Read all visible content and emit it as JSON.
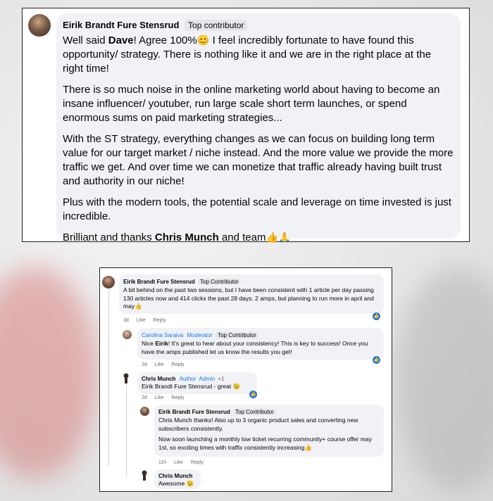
{
  "post1": {
    "author": "Eirik Brandt Fure Stensrud",
    "badge": "Top contributor",
    "p1_pre": "Well said ",
    "p1_bold": "Dave",
    "p1_mid": "! Agree 100%",
    "p1_emoji": "😊",
    "p1_post": " I feel incredibly fortunate to have found this opportunity/ strategy. There is nothing like it and we are in the right place at the right time!",
    "p2": "There is so much noise in the online marketing world about having to become an insane influencer/ youtuber, run large scale short term launches, or spend enormous sums on paid marketing strategies...",
    "p3": "With the ST strategy, everything changes as we can focus on building long term value for our target market / niche instead. And the more value we provide the more traffic we get. And over time we can monetize that traffic already having built trust and authority in our niche!",
    "p4": "Plus with the modern tools, the potential scale and leverage on time invested is just incredible.",
    "p5_pre": "Brilliant and thanks ",
    "p5_bold": "Chris Munch",
    "p5_post": " and team",
    "p5_emoji": "👍🙏"
  },
  "thread": {
    "c1": {
      "author": "Eirik Brandt Fure Stensrud",
      "badge": "Top Contributor",
      "text": "A bit behind on the past two sessions, but I have been consistent with 1 article per day passing 130 articles now and 414 clicks the past 28 days. 2 amps, but planning to run more in april and may",
      "emoji": "👍",
      "time": "3d",
      "like": "Like",
      "reply": "Reply"
    },
    "c2": {
      "author": "Carolina Saraiva",
      "role": "Moderator",
      "badge": "Top Contributor",
      "text_pre": "Nice ",
      "text_bold": "Eirik",
      "text_post": "! It's great to hear about your consistency! This is key to success! Once you have the amps published let us know the results you get!",
      "time": "2d",
      "like": "Like",
      "reply": "Reply"
    },
    "c3": {
      "author": "Chris Munch",
      "role1": "Author",
      "role2": "Admin",
      "extra": "+1",
      "text_bold": "Eirik Brandt Fure Stensrud",
      "text_post": " - great ",
      "emoji": "😉",
      "time": "2d",
      "like": "Like",
      "reply": "Reply"
    },
    "c4": {
      "author": "Eirik Brandt Fure Stensrud",
      "badge": "Top Contributor",
      "text1_pre": "Chris Munch",
      "text1_post": " thanks! Also up to 3 organic product sales and converting new subscribers consistently.",
      "text2": "Now soon launching a monthly low ticket recurring community+ course offer may 1st, so exciting times with traffix consistently increasing",
      "emoji": "👍",
      "time": "11h",
      "like": "Like",
      "reply": "Reply"
    },
    "c5": {
      "author": "Chris Munch",
      "text": "Awesome ",
      "emoji": "😉"
    }
  }
}
